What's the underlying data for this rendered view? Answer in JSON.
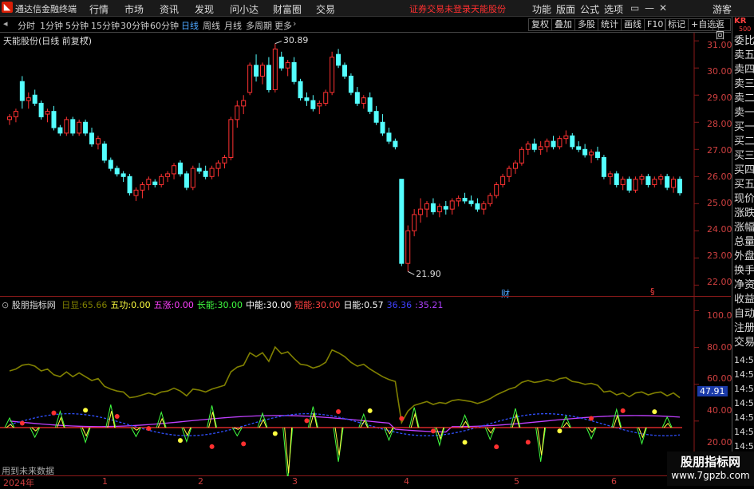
{
  "menubar": {
    "app_name": "通达信金融终端",
    "items": [
      "行情",
      "市场",
      "资讯",
      "发现",
      "问小达",
      "财富圈",
      "交易"
    ],
    "alert_text": "证券交易未登录",
    "stock_name": "天能股份",
    "tools": [
      "功能",
      "版面",
      "公式",
      "选项"
    ],
    "guest": "游客"
  },
  "periodbar": {
    "periods": [
      "分时",
      "1分钟",
      "5分钟",
      "15分钟",
      "30分钟",
      "60分钟",
      "日线",
      "周线",
      "月线",
      "多周期",
      "更多"
    ],
    "active": "日线",
    "buttons": [
      "复权",
      "叠加",
      "多股",
      "统计",
      "画线",
      "F10",
      "标记",
      "+自选",
      "返回"
    ]
  },
  "main_chart": {
    "title": "天能股份(日线 前复权)",
    "high_label": "30.89",
    "low_label": "21.90",
    "fin_marker": "财",
    "dividend_marker": "§",
    "yaxis": [
      "31.00",
      "30.00",
      "29.00",
      "28.00",
      "27.00",
      "26.00",
      "25.00",
      "24.00",
      "23.00",
      "22.00"
    ]
  },
  "indicator": {
    "name": "股朋指标网",
    "fields": [
      {
        "label": "日显:",
        "value": "65.66",
        "color": "#808000"
      },
      {
        "label": "五功:",
        "value": "0.00",
        "color": "#ffff40"
      },
      {
        "label": "五涨:",
        "value": "0.00",
        "color": "#ff40ff"
      },
      {
        "label": "长能:",
        "value": "30.00",
        "color": "#40ff40"
      },
      {
        "label": "中能:",
        "value": "30.00",
        "color": "#ffffff"
      },
      {
        "label": "短能:",
        "value": "30.00",
        "color": "#ff4040"
      },
      {
        "label": "日能:",
        "value": "0.57",
        "color": "#ffffff"
      },
      {
        "label": "",
        "value": "36.36",
        "color": "#4040ff"
      },
      {
        "label": ":",
        "value": "35.21",
        "color": "#b040ff"
      }
    ],
    "yaxis": [
      "100.0",
      "80.00",
      "60.00",
      "40.00",
      "20.00"
    ],
    "current_tag": "47.91",
    "future_note": "用到未来数据"
  },
  "xaxis": [
    "2024年",
    "1",
    "2",
    "3",
    "4",
    "5",
    "6"
  ],
  "rightpanel": {
    "code": "KR",
    "code_sub": "500",
    "items": [
      "委比",
      "卖五",
      "卖四",
      "卖三",
      "卖二",
      "卖一",
      "买一",
      "买二",
      "买三",
      "买四",
      "买五",
      "现价",
      "涨跌",
      "涨幅",
      "总量",
      "外盘",
      "换手",
      "净资",
      "收益",
      "自动",
      "注册",
      "交易"
    ],
    "times": [
      "14:56",
      "14:56",
      "14:56",
      "14:56",
      "14:56",
      "14:56",
      "14:56",
      "14:56"
    ]
  },
  "watermark": {
    "line1": "股朋指标网",
    "line2": "www.7gpzb.com"
  },
  "colors": {
    "up": "#ff3232",
    "down": "#54ffff",
    "axis": "#d04040",
    "ma": "#808000"
  },
  "chart_data": {
    "type": "candlestick",
    "ylim": [
      21.6,
      31.3
    ],
    "candles": [
      [
        28.1,
        28.3,
        27.9,
        28.2
      ],
      [
        28.2,
        28.5,
        28.0,
        28.4
      ],
      [
        29.5,
        29.7,
        28.5,
        28.8
      ],
      [
        28.8,
        29.1,
        28.5,
        28.9
      ],
      [
        29.0,
        29.2,
        28.6,
        28.7
      ],
      [
        28.7,
        28.8,
        28.1,
        28.2
      ],
      [
        28.3,
        28.5,
        28.0,
        28.4
      ],
      [
        28.4,
        28.6,
        27.7,
        27.8
      ],
      [
        27.8,
        27.9,
        27.5,
        27.6
      ],
      [
        27.6,
        28.2,
        27.5,
        28.1
      ],
      [
        28.1,
        28.2,
        27.5,
        27.6
      ],
      [
        27.6,
        28.1,
        27.5,
        28.0
      ],
      [
        28.0,
        28.1,
        27.5,
        27.6
      ],
      [
        27.6,
        27.8,
        27.1,
        27.2
      ],
      [
        27.2,
        27.5,
        27.0,
        27.4
      ],
      [
        27.2,
        27.3,
        26.5,
        26.6
      ],
      [
        26.6,
        26.7,
        26.2,
        26.3
      ],
      [
        26.3,
        26.4,
        26.0,
        26.1
      ],
      [
        26.1,
        26.2,
        25.8,
        26.0
      ],
      [
        26.0,
        26.1,
        25.3,
        25.4
      ],
      [
        25.3,
        25.6,
        25.1,
        25.5
      ],
      [
        25.5,
        25.8,
        25.2,
        25.7
      ],
      [
        25.7,
        26.0,
        25.5,
        25.9
      ],
      [
        25.8,
        25.9,
        25.6,
        25.7
      ],
      [
        25.7,
        26.1,
        25.6,
        26.0
      ],
      [
        26.0,
        26.2,
        25.8,
        26.1
      ],
      [
        26.1,
        26.5,
        25.9,
        26.4
      ],
      [
        26.5,
        26.6,
        26.0,
        26.1
      ],
      [
        26.1,
        26.2,
        25.5,
        25.6
      ],
      [
        25.6,
        26.4,
        25.5,
        26.3
      ],
      [
        26.3,
        26.5,
        26.1,
        26.2
      ],
      [
        26.2,
        26.4,
        25.9,
        26.0
      ],
      [
        26.0,
        26.4,
        25.9,
        26.3
      ],
      [
        26.3,
        26.6,
        26.0,
        26.5
      ],
      [
        26.5,
        26.8,
        26.3,
        26.7
      ],
      [
        26.7,
        28.2,
        26.6,
        28.1
      ],
      [
        28.1,
        28.8,
        27.8,
        28.6
      ],
      [
        28.6,
        29.0,
        28.3,
        28.8
      ],
      [
        29.1,
        30.2,
        29.0,
        30.1
      ],
      [
        30.1,
        30.5,
        29.5,
        29.7
      ],
      [
        29.7,
        30.2,
        29.4,
        30.1
      ],
      [
        30.1,
        30.4,
        29.1,
        29.2
      ],
      [
        29.2,
        30.9,
        29.1,
        30.7
      ],
      [
        30.4,
        30.6,
        29.9,
        30.0
      ],
      [
        30.0,
        30.3,
        29.7,
        30.2
      ],
      [
        30.2,
        30.4,
        29.4,
        29.5
      ],
      [
        29.5,
        29.6,
        28.8,
        28.9
      ],
      [
        28.9,
        29.1,
        28.6,
        28.8
      ],
      [
        28.8,
        29.0,
        28.4,
        28.5
      ],
      [
        28.6,
        28.8,
        28.3,
        28.7
      ],
      [
        28.7,
        29.2,
        28.6,
        29.1
      ],
      [
        29.1,
        30.6,
        29.0,
        30.4
      ],
      [
        30.5,
        30.7,
        30.0,
        30.1
      ],
      [
        30.1,
        30.2,
        29.6,
        29.7
      ],
      [
        29.7,
        29.8,
        29.0,
        29.1
      ],
      [
        29.1,
        29.3,
        28.6,
        28.7
      ],
      [
        28.7,
        29.0,
        28.5,
        28.9
      ],
      [
        28.9,
        29.1,
        28.3,
        28.4
      ],
      [
        28.4,
        28.6,
        27.9,
        28.0
      ],
      [
        28.0,
        28.3,
        27.5,
        27.6
      ],
      [
        27.6,
        27.8,
        27.2,
        27.3
      ],
      [
        27.3,
        27.4,
        27.0,
        27.1
      ],
      [
        25.9,
        25.9,
        22.7,
        22.8
      ],
      [
        22.8,
        24.2,
        22.5,
        24.0
      ],
      [
        24.0,
        24.8,
        23.8,
        24.6
      ],
      [
        24.6,
        25.2,
        24.3,
        24.8
      ],
      [
        24.8,
        25.1,
        24.5,
        25.0
      ],
      [
        25.0,
        25.2,
        24.6,
        24.7
      ],
      [
        24.7,
        25.0,
        24.5,
        24.9
      ],
      [
        24.9,
        25.1,
        24.6,
        24.8
      ],
      [
        24.8,
        25.2,
        24.6,
        25.1
      ],
      [
        25.1,
        25.3,
        24.9,
        25.2
      ],
      [
        25.2,
        25.4,
        25.0,
        25.1
      ],
      [
        25.1,
        25.3,
        24.9,
        25.0
      ],
      [
        25.0,
        25.2,
        24.7,
        24.8
      ],
      [
        24.8,
        25.1,
        24.6,
        25.0
      ],
      [
        25.0,
        25.4,
        24.9,
        25.3
      ],
      [
        25.3,
        25.8,
        25.2,
        25.7
      ],
      [
        25.7,
        26.1,
        25.6,
        26.0
      ],
      [
        26.0,
        26.4,
        25.8,
        26.3
      ],
      [
        26.3,
        26.6,
        26.1,
        26.5
      ],
      [
        26.5,
        27.1,
        26.4,
        27.0
      ],
      [
        27.0,
        27.3,
        26.8,
        27.2
      ],
      [
        27.2,
        27.4,
        26.9,
        27.0
      ],
      [
        27.0,
        27.3,
        26.8,
        27.1
      ],
      [
        27.1,
        27.4,
        26.9,
        27.3
      ],
      [
        27.3,
        27.5,
        27.0,
        27.1
      ],
      [
        27.1,
        27.5,
        27.0,
        27.4
      ],
      [
        27.4,
        27.7,
        27.2,
        27.5
      ],
      [
        27.5,
        27.6,
        27.0,
        27.1
      ],
      [
        27.1,
        27.3,
        26.9,
        27.0
      ],
      [
        27.0,
        27.2,
        26.7,
        26.8
      ],
      [
        26.8,
        27.0,
        26.5,
        26.9
      ],
      [
        26.9,
        27.1,
        26.6,
        26.7
      ],
      [
        26.7,
        26.8,
        25.9,
        26.0
      ],
      [
        26.0,
        26.2,
        25.7,
        26.1
      ],
      [
        26.1,
        26.2,
        25.6,
        25.7
      ],
      [
        25.7,
        26.0,
        25.5,
        25.9
      ],
      [
        25.9,
        26.0,
        25.4,
        25.5
      ],
      [
        25.5,
        26.0,
        25.4,
        25.9
      ],
      [
        25.9,
        26.1,
        25.7,
        26.0
      ],
      [
        26.0,
        26.1,
        25.6,
        25.7
      ],
      [
        25.7,
        26.0,
        25.6,
        25.9
      ],
      [
        25.9,
        26.1,
        25.7,
        26.0
      ],
      [
        26.0,
        26.1,
        25.5,
        25.6
      ],
      [
        25.6,
        26.0,
        25.4,
        25.9
      ],
      [
        25.9,
        26.0,
        25.3,
        25.4
      ]
    ],
    "indicator_ylim": [
      10,
      108
    ]
  }
}
